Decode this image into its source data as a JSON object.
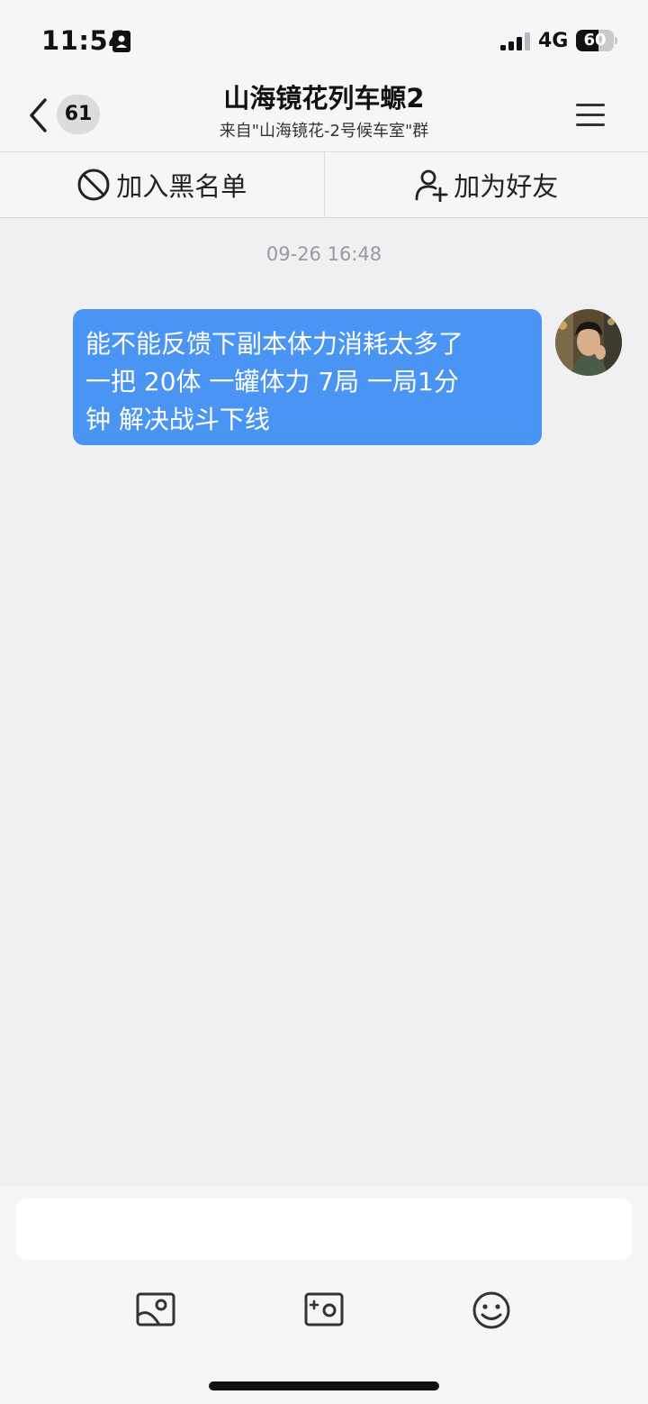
{
  "status_bar": {
    "time": "11:54",
    "network": "4G",
    "battery_level": "60",
    "battery_fraction": 0.6,
    "icons": [
      "id-card-icon",
      "signal-icon",
      "battery-icon"
    ]
  },
  "header": {
    "unread_count": "61",
    "title": "山海镜花列车螈2",
    "subtitle": "来自\"山海镜花-2号候车室\"群",
    "icons": [
      "chevron-left-icon",
      "menu-icon"
    ]
  },
  "actions": {
    "blacklist_label": "加入黑名单",
    "add_friend_label": "加为好友",
    "icons": [
      "block-icon",
      "add-user-icon"
    ]
  },
  "chat": {
    "timestamp": "09-26 16:48",
    "messages": [
      {
        "lines": [
          "能不能反馈下副本体力消耗太多了",
          "一把 20体  一罐体力 7局  一局1分",
          "钟  解决战斗下线"
        ]
      }
    ]
  },
  "composer": {
    "placeholder": "",
    "tools": [
      "image-icon",
      "camera-icon",
      "emoji-icon"
    ]
  },
  "colors": {
    "bubble": "#4a95f4",
    "background": "#f0f0f2",
    "bar": "#f6f6f8"
  }
}
